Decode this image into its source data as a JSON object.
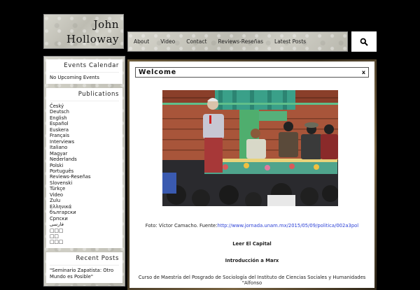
{
  "site": {
    "title_line1": "John",
    "title_line2": "Holloway"
  },
  "nav": {
    "items": [
      "About",
      "Video",
      "Contact",
      "Reviews-Reseñas",
      "Latest Posts"
    ]
  },
  "search": {
    "icon": "search-icon"
  },
  "sidebar": {
    "events": {
      "title": "Events Calendar",
      "text": "No Upcoming Events"
    },
    "publications": {
      "title": "Publications",
      "items": [
        "Český",
        "Deutsch",
        "English",
        "Español",
        "Euskera",
        "Français",
        "Interviews",
        "Italiano",
        "Magyar",
        "Nederlands",
        "Polski",
        "Português",
        "Reviews-Reseñas",
        "Slovenski",
        "Türkçe",
        "Video",
        "Zulu",
        "Ελληνικά",
        "български",
        "Српски",
        "فارسی",
        "□□□",
        "□□",
        "□□□"
      ]
    },
    "recent": {
      "title": "Recent Posts",
      "item1": "\"Seminario Zapatista: Otro Mundo es Posible\""
    }
  },
  "main": {
    "welcome_title": "Welcome",
    "close_label": "x",
    "caption_prefix": "Foto: Víctor Camacho. Fuente:",
    "caption_link": "http://www.jornada.unam.mx/2015/05/09/politica/002a3pol",
    "line1": "Leer El Capital",
    "line2": "Introducción a Marx",
    "line3": "Curso de Maestría del Posgrado de Sociología del Instituto de Ciencias Sociales y Humanidades \"Alfonso"
  }
}
